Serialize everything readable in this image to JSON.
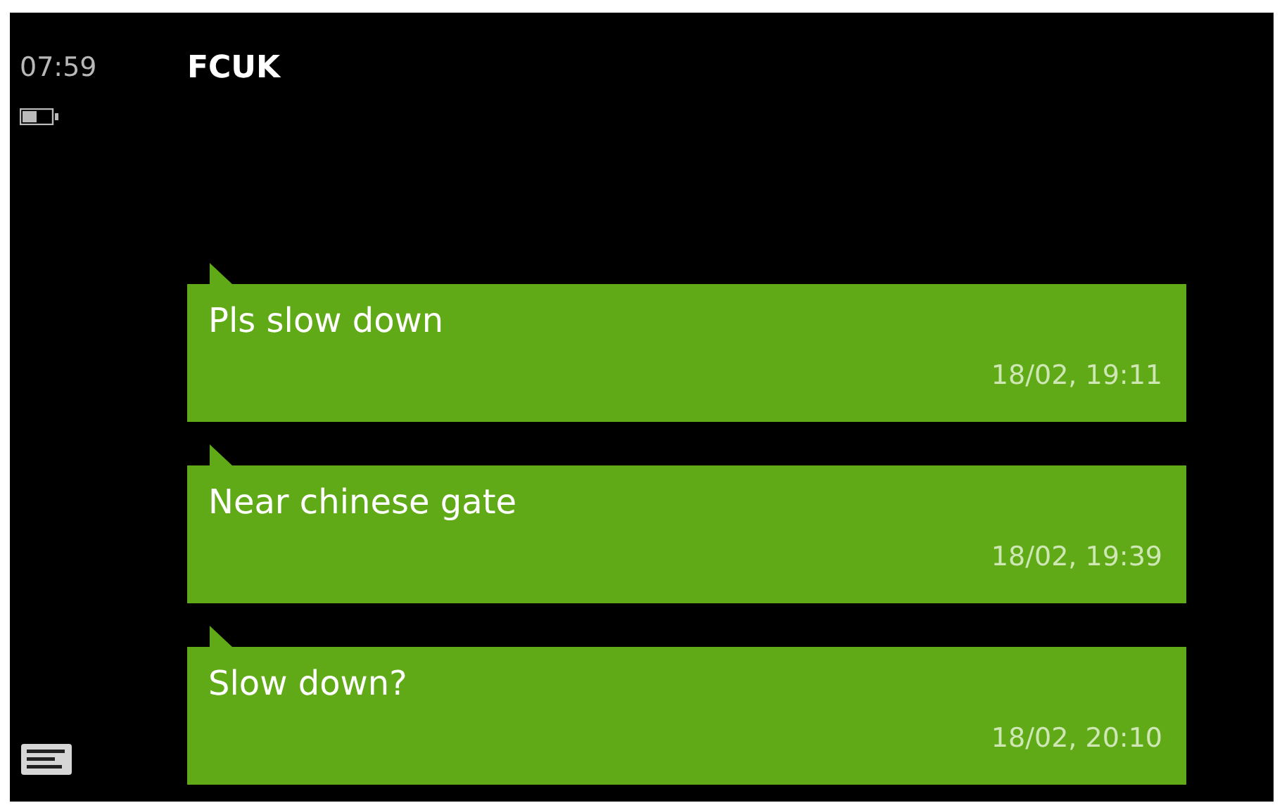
{
  "status_bar": {
    "time": "07:59"
  },
  "conversation": {
    "title": "FCUK"
  },
  "messages": [
    {
      "text": "Pls slow down",
      "timestamp": "18/02, 19:11"
    },
    {
      "text": "Near chinese gate",
      "timestamp": "18/02, 19:39"
    },
    {
      "text": "Slow down?",
      "timestamp": "18/02, 20:10"
    }
  ]
}
